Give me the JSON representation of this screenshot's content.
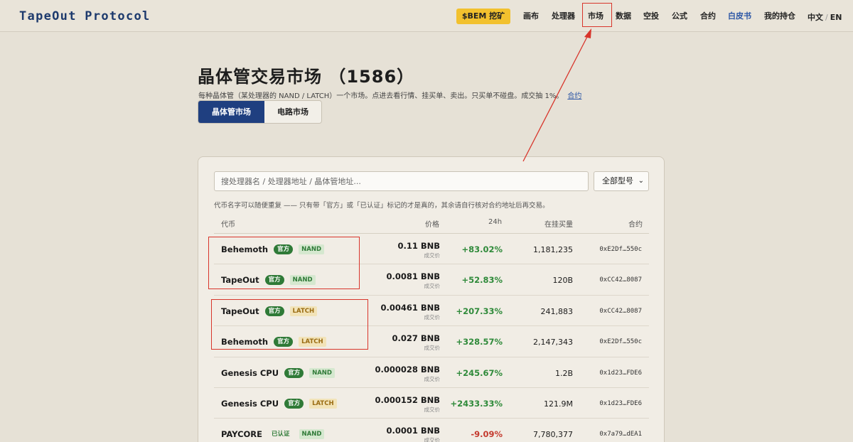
{
  "header": {
    "logo": "TapeOut Protocol",
    "mine_button": "$BEM 挖矿",
    "nav": [
      "画布",
      "处理器",
      "市场",
      "数据",
      "空投",
      "公式",
      "合约",
      "白皮书",
      "我的持仓"
    ],
    "lang_zh": "中文",
    "lang_sep": "/",
    "lang_en": "EN"
  },
  "page": {
    "title": "晶体管交易市场 （1586）",
    "subtitle": "每种晶体管（某处理器的 NAND / LATCH）一个市场。点进去看行情、挂买单、卖出。只买单不碰盘。成交抽 1%。",
    "subtitle_link": "合约",
    "tabs": [
      "晶体管市场",
      "电路市场"
    ]
  },
  "market": {
    "search_placeholder": "搜处理器名 / 处理器地址 / 晶体管地址...",
    "filter_value": "全部型号",
    "warning": "代币名字可以随便重复 —— 只有带「官方」或「已认证」标记的才是真的，其余请自行核对合约地址后再交易。",
    "columns": {
      "token": "代币",
      "price": "价格",
      "change": "24h",
      "volume": "在挂买量",
      "contract": "合约"
    },
    "price_label": "成交价",
    "rows": [
      {
        "name": "Behemoth",
        "badge": "官方",
        "type": "NAND",
        "price": "0.11 BNB",
        "change": "+83.02%",
        "volume": "1,181,235",
        "contract": "0xE2Df…550c"
      },
      {
        "name": "TapeOut",
        "badge": "官方",
        "type": "NAND",
        "price": "0.0081 BNB",
        "change": "+52.83%",
        "volume": "120B",
        "contract": "0xCC42…8087"
      },
      {
        "name": "TapeOut",
        "badge": "官方",
        "type": "LATCH",
        "price": "0.00461 BNB",
        "change": "+207.33%",
        "volume": "241,883",
        "contract": "0xCC42…8087"
      },
      {
        "name": "Behemoth",
        "badge": "官方",
        "type": "LATCH",
        "price": "0.027 BNB",
        "change": "+328.57%",
        "volume": "2,147,343",
        "contract": "0xE2Df…550c"
      },
      {
        "name": "Genesis CPU",
        "badge": "官方",
        "type": "NAND",
        "price": "0.000028 BNB",
        "change": "+245.67%",
        "volume": "1.2B",
        "contract": "0x1d23…FDE6"
      },
      {
        "name": "Genesis CPU",
        "badge": "官方",
        "type": "LATCH",
        "price": "0.000152 BNB",
        "change": "+2433.33%",
        "volume": "121.9M",
        "contract": "0x1d23…FDE6"
      },
      {
        "name": "PAYCORE",
        "badge": "已认证",
        "type": "NAND",
        "price": "0.0001 BNB",
        "change": "-9.09%",
        "volume": "7,780,377",
        "contract": "0x7a79…dEA1"
      }
    ]
  },
  "colors": {
    "accent": "#1f3f80",
    "gold": "#f2c12e",
    "up": "#2f8a3a",
    "down": "#c43a2e",
    "annotation": "#d8352b"
  }
}
